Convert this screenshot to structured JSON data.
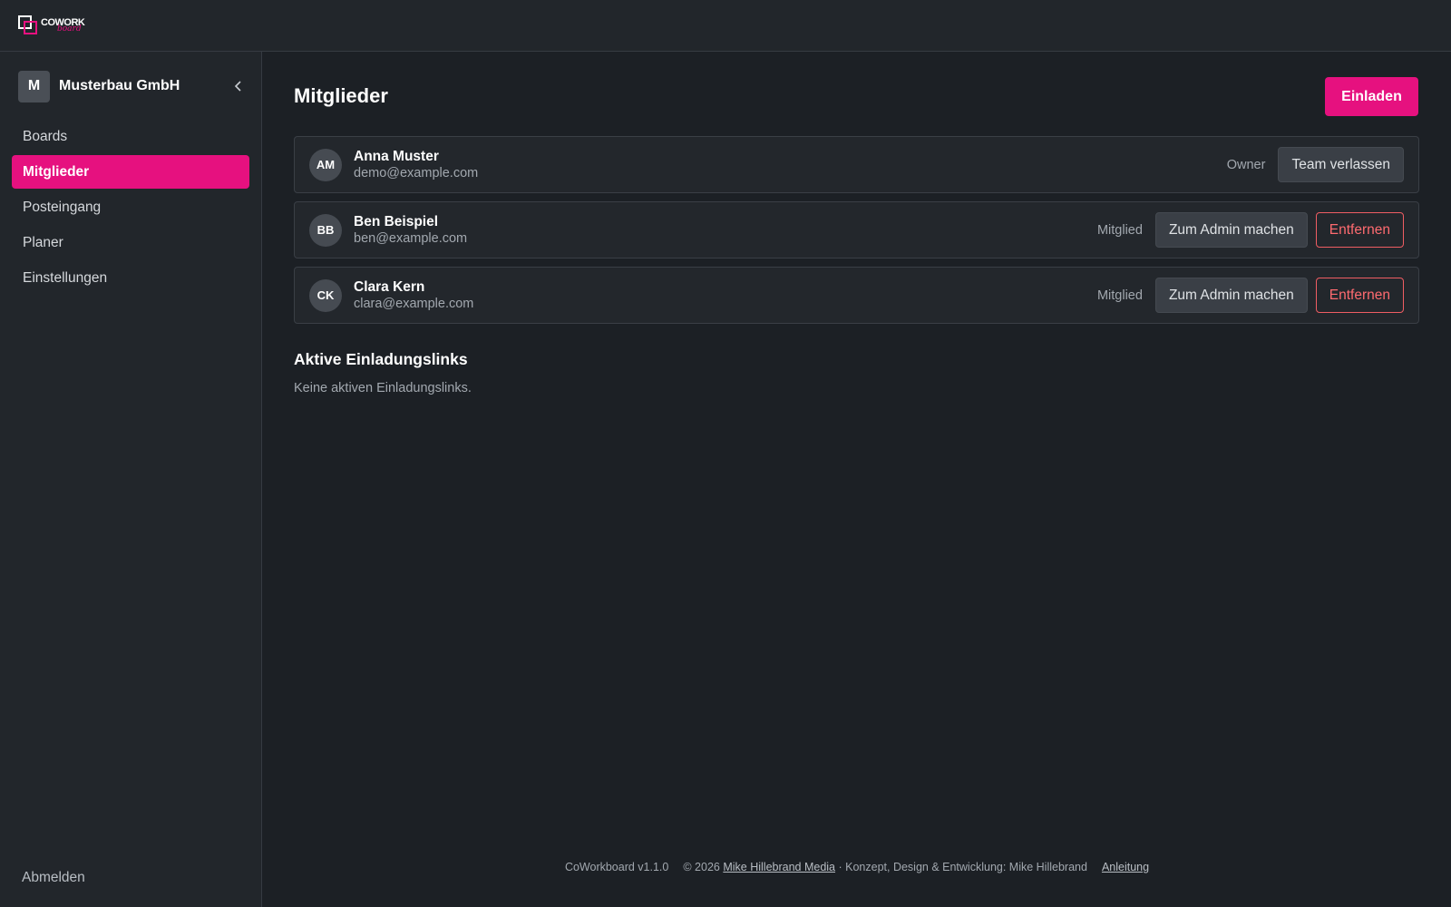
{
  "brand": {
    "logo_word": "COWORK",
    "logo_script": "board"
  },
  "sidebar": {
    "team": {
      "initial": "M",
      "name": "Musterbau GmbH"
    },
    "items": [
      {
        "label": "Boards",
        "active": false
      },
      {
        "label": "Mitglieder",
        "active": true
      },
      {
        "label": "Posteingang",
        "active": false
      },
      {
        "label": "Planer",
        "active": false
      },
      {
        "label": "Einstellungen",
        "active": false
      }
    ],
    "logout_label": "Abmelden"
  },
  "main": {
    "title": "Mitglieder",
    "invite_label": "Einladen",
    "members": [
      {
        "initials": "AM",
        "name": "Anna Muster",
        "email": "demo@example.com",
        "role": "Owner",
        "secondary_action": "Team verlassen"
      },
      {
        "initials": "BB",
        "name": "Ben Beispiel",
        "email": "ben@example.com",
        "role": "Mitglied",
        "secondary_action": "Zum Admin machen",
        "danger_action": "Entfernen"
      },
      {
        "initials": "CK",
        "name": "Clara Kern",
        "email": "clara@example.com",
        "role": "Mitglied",
        "secondary_action": "Zum Admin machen",
        "danger_action": "Entfernen"
      }
    ],
    "invites_title": "Aktive Einladungslinks",
    "invites_empty": "Keine aktiven Einladungslinks."
  },
  "footer": {
    "version": "CoWorkboard v1.1.0",
    "copyright": "© 2026",
    "company_link": "Mike Hillebrand Media",
    "credits": "· Konzept, Design & Entwicklung: Mike Hillebrand",
    "help_link": "Anleitung"
  },
  "colors": {
    "accent": "#e6117f",
    "danger": "#ff6b70",
    "background": "#1c2025",
    "panel": "#22262b"
  }
}
